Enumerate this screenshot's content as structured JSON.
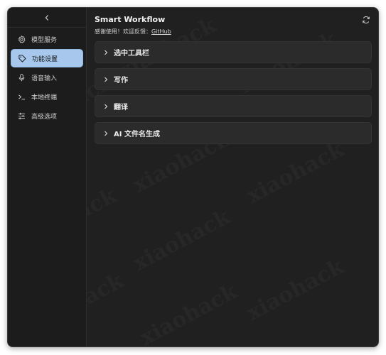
{
  "sidebar": {
    "collapse_glyph": "‹",
    "items": [
      {
        "label": "模型服务",
        "icon": "gear-icon",
        "active": false
      },
      {
        "label": "功能设置",
        "icon": "tag-icon",
        "active": true
      },
      {
        "label": "语音输入",
        "icon": "microphone-icon",
        "active": false
      },
      {
        "label": "本地终端",
        "icon": "terminal-icon",
        "active": false
      },
      {
        "label": "高级选项",
        "icon": "sliders-icon",
        "active": false
      }
    ]
  },
  "main": {
    "title": "Smart Workflow",
    "subtitle_prefix": "感谢使用！欢迎反馈：",
    "subtitle_link": "GitHub",
    "panels": [
      {
        "label": "选中工具栏"
      },
      {
        "label": "写作"
      },
      {
        "label": "翻译"
      },
      {
        "label": "AI 文件名生成"
      }
    ]
  },
  "watermark_text": "xiaohack",
  "colors": {
    "window_bg": "#202020",
    "sidebar_bg": "#1c1c1c",
    "panel_bg": "#2b2b2b",
    "active_bg": "#a7c8ec"
  }
}
